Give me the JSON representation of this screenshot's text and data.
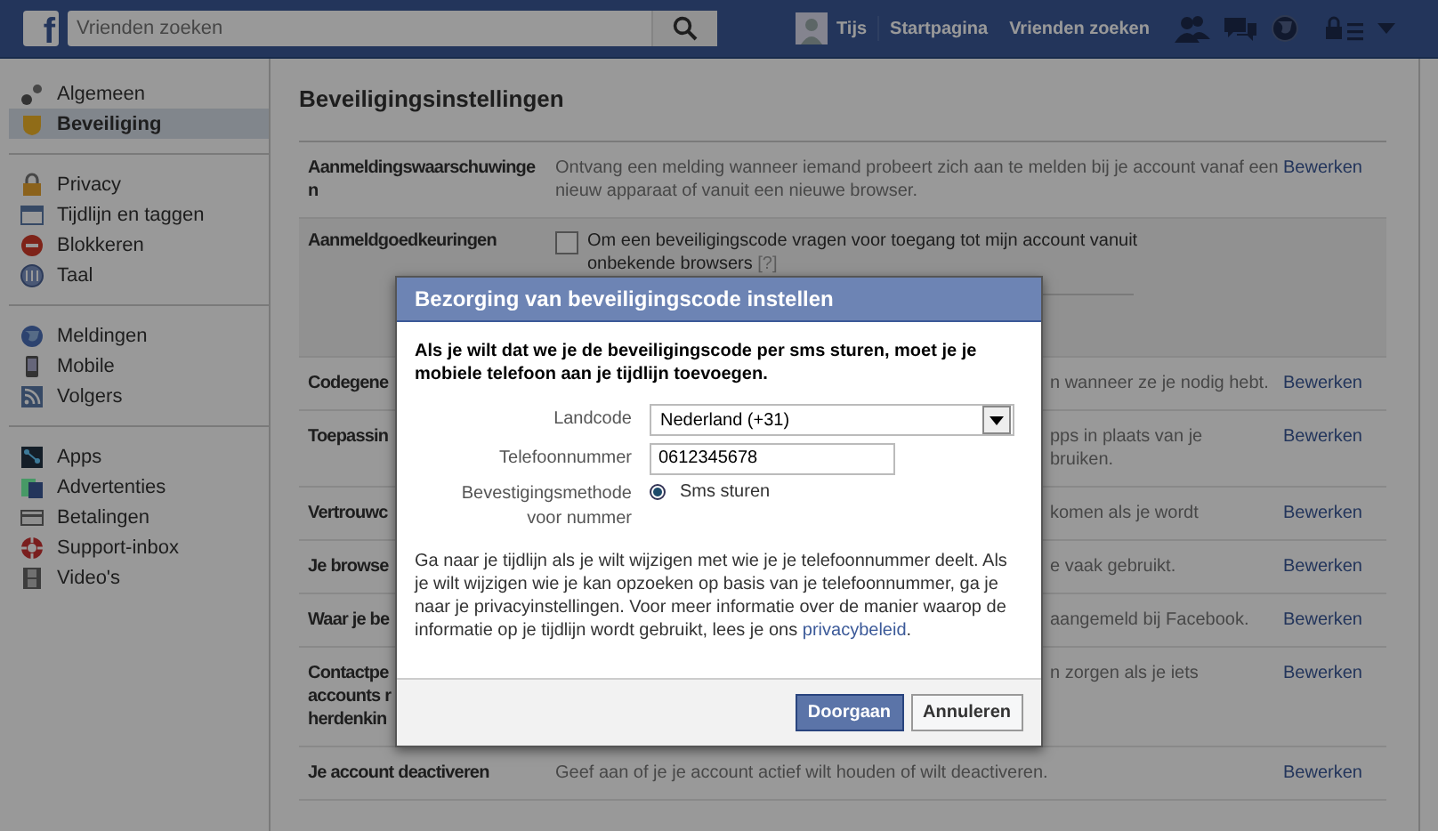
{
  "top_bar": {
    "logo": "f",
    "search": {
      "placeholder": "Vrienden zoeken"
    },
    "user": "Tijs",
    "nav": [
      "Startpagina",
      "Vrienden zoeken"
    ]
  },
  "sidebar": {
    "groups": [
      [
        {
          "label": "Algemeen",
          "selected": false
        },
        {
          "label": "Beveiliging",
          "selected": true
        }
      ],
      [
        {
          "label": "Privacy",
          "selected": false
        },
        {
          "label": "Tijdlijn en taggen",
          "selected": false
        },
        {
          "label": "Blokkeren",
          "selected": false
        },
        {
          "label": "Taal",
          "selected": false
        }
      ],
      [
        {
          "label": "Meldingen",
          "selected": false
        },
        {
          "label": "Mobile",
          "selected": false
        },
        {
          "label": "Volgers",
          "selected": false
        }
      ],
      [
        {
          "label": "Apps",
          "selected": false
        },
        {
          "label": "Advertenties",
          "selected": false
        },
        {
          "label": "Betalingen",
          "selected": false
        },
        {
          "label": "Support-inbox",
          "selected": false
        },
        {
          "label": "Video's",
          "selected": false
        }
      ]
    ]
  },
  "settings": {
    "title": "Beveiligingsinstellingen",
    "rows": [
      {
        "kind": "text",
        "label": "Aanmeldingswaarschuwinge\nn",
        "description": "Ontvang een melding wanneer iemand probeert zich aan te melden bij je account vanaf een nieuw apparaat of vanuit een nieuwe browser.",
        "action": "Bewerken"
      },
      {
        "kind": "checkbox",
        "label": "Aanmeldgoedkeuringen",
        "description": "Om een beveiligingscode vragen voor toegang tot mijn account vanuit onbekende browsers",
        "help": "[?]",
        "checked": false
      },
      {
        "kind": "covered",
        "label": "Codegene",
        "description": "n wanneer ze je nodig hebt.",
        "action": "Bewerken"
      },
      {
        "kind": "covered",
        "label": "Toepassin",
        "description": "pps in plaats van je\nbruiken.",
        "action": "Bewerken"
      },
      {
        "kind": "covered",
        "label": "Vertrouwc",
        "description": "komen als je wordt",
        "action": "Bewerken"
      },
      {
        "kind": "covered",
        "label": "Je browse",
        "description": "e vaak gebruikt.",
        "action": "Bewerken"
      },
      {
        "kind": "covered",
        "label": "Waar je be",
        "description": "aangemeld bij Facebook.",
        "action": "Bewerken"
      },
      {
        "kind": "covered",
        "label": "Contactpe\naccounts r\nherdenkin",
        "description": "n zorgen als je iets",
        "action": "Bewerken"
      },
      {
        "kind": "text",
        "label": "Je account deactiveren",
        "description": "Geef aan of je je account actief wilt houden of wilt deactiveren.",
        "action": "Bewerken"
      }
    ]
  },
  "dialog": {
    "title": "Bezorging van beveiligingscode instellen",
    "intro": "Als je wilt dat we je de beveiligingscode per sms sturen, moet je je mobiele telefoon aan je tijdlijn toevoegen.",
    "country": {
      "label": "Landcode",
      "value": "Nederland (+31)"
    },
    "phone": {
      "label": "Telefoonnummer",
      "value": "0612345678"
    },
    "method": {
      "label": "Bevestigingsmethode voor nummer",
      "options": [
        {
          "label": "Sms sturen",
          "selected": true
        }
      ]
    },
    "info": {
      "text": "Ga naar je tijdlijn als je wilt wijzigen met wie je je telefoonnummer deelt. Als je wilt wijzigen wie je kan opzoeken op basis van je telefoonnummer, ga je naar je privacyinstellingen. Voor meer informatie over de manier waarop de informatie op je tijdlijn wordt gebruikt, lees je ons",
      "link": "privacybeleid",
      "after": "."
    },
    "buttons": [
      {
        "label": "Doorgaan",
        "kind": "primary"
      },
      {
        "label": "Annuleren",
        "kind": "secondary"
      }
    ]
  }
}
